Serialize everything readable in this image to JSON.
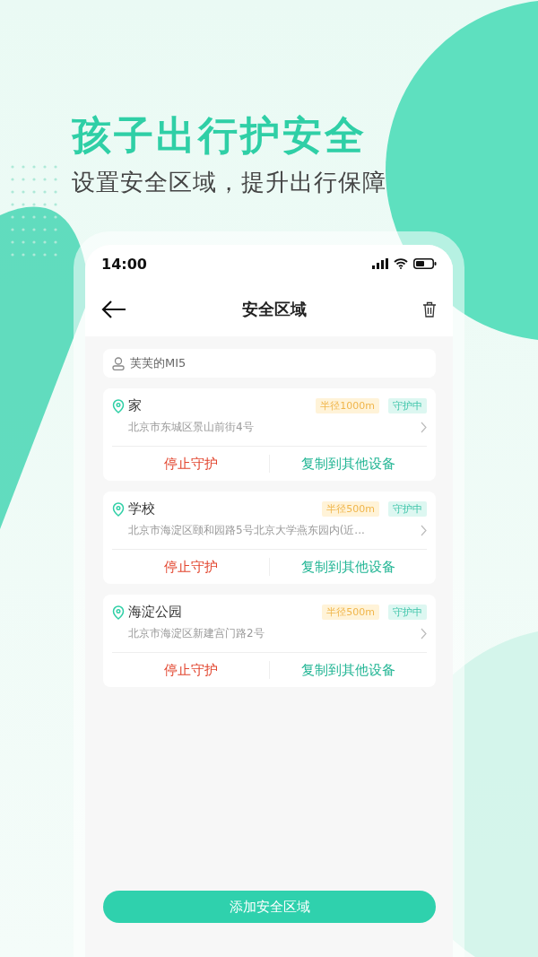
{
  "headline": "孩子出行护安全",
  "subheadline": "设置安全区域，提升出行保障",
  "status_bar": {
    "time": "14:00"
  },
  "nav": {
    "title": "安全区域"
  },
  "device": {
    "name": "芙芙的MI5"
  },
  "zones": [
    {
      "name": "家",
      "radius": "半径1000m",
      "status": "守护中",
      "address": "北京市东城区景山前街4号",
      "stop": "停止守护",
      "copy": "复制到其他设备"
    },
    {
      "name": "学校",
      "radius": "半径500m",
      "status": "守护中",
      "address": "北京市海淀区颐和园路5号北京大学燕东园内(近...",
      "stop": "停止守护",
      "copy": "复制到其他设备"
    },
    {
      "name": "海淀公园",
      "radius": "半径500m",
      "status": "守护中",
      "address": "北京市海淀区新建宫门路2号",
      "stop": "停止守护",
      "copy": "复制到其他设备"
    }
  ],
  "add_button": "添加安全区域"
}
